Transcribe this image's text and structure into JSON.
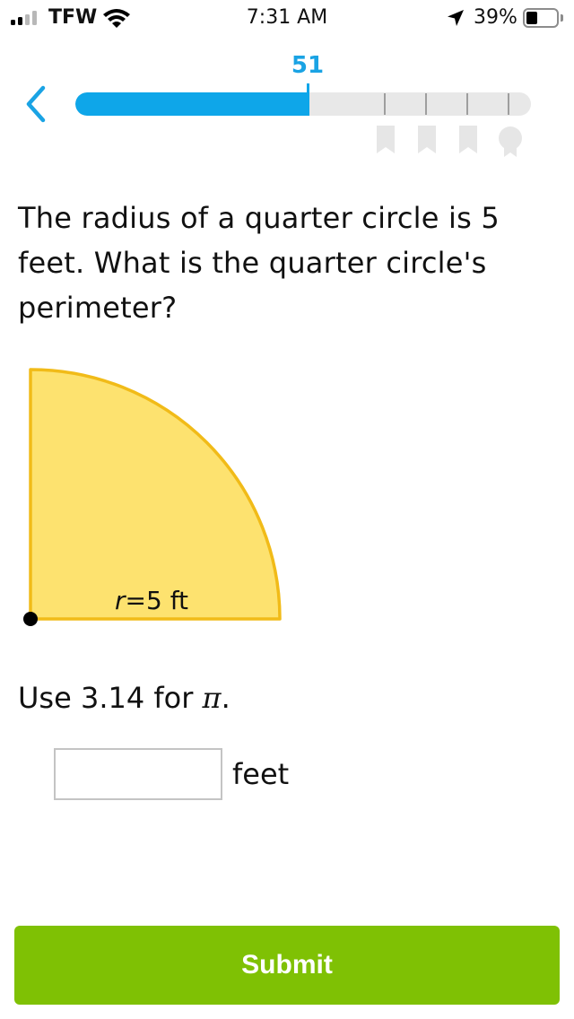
{
  "status_bar": {
    "carrier": "TFW",
    "time": "7:31 AM",
    "battery_percent": "39%",
    "battery_level": 0.39,
    "signal_bars_filled": 2,
    "signal_bars_total": 4,
    "icons": [
      "signal-icon",
      "wifi-icon",
      "location-arrow-icon",
      "battery-icon"
    ]
  },
  "progress": {
    "score": "51",
    "fraction": 0.51,
    "milestone_count": 4,
    "milestone_icons": [
      "bookmark-icon",
      "bookmark-icon",
      "bookmark-icon",
      "award-ribbon-icon"
    ],
    "colors": {
      "fill": "#0ea6e9",
      "track": "#e8e8e8",
      "score": "#1aa3e4"
    }
  },
  "back_icon": "chevron-left-icon",
  "question": {
    "text": "The radius of a quarter circle is 5 feet. What is the quarter circle's perimeter?"
  },
  "figure": {
    "radius_variable": "r",
    "radius_value": "=5 ft",
    "fill_color": "#fde26f",
    "stroke_color": "#f1bb18"
  },
  "hint": {
    "prefix": "Use 3.14 for ",
    "symbol": "π",
    "suffix": "."
  },
  "answer": {
    "value": "",
    "placeholder": "",
    "unit": "feet"
  },
  "submit": {
    "label": "Submit",
    "color": "#7fc104"
  }
}
